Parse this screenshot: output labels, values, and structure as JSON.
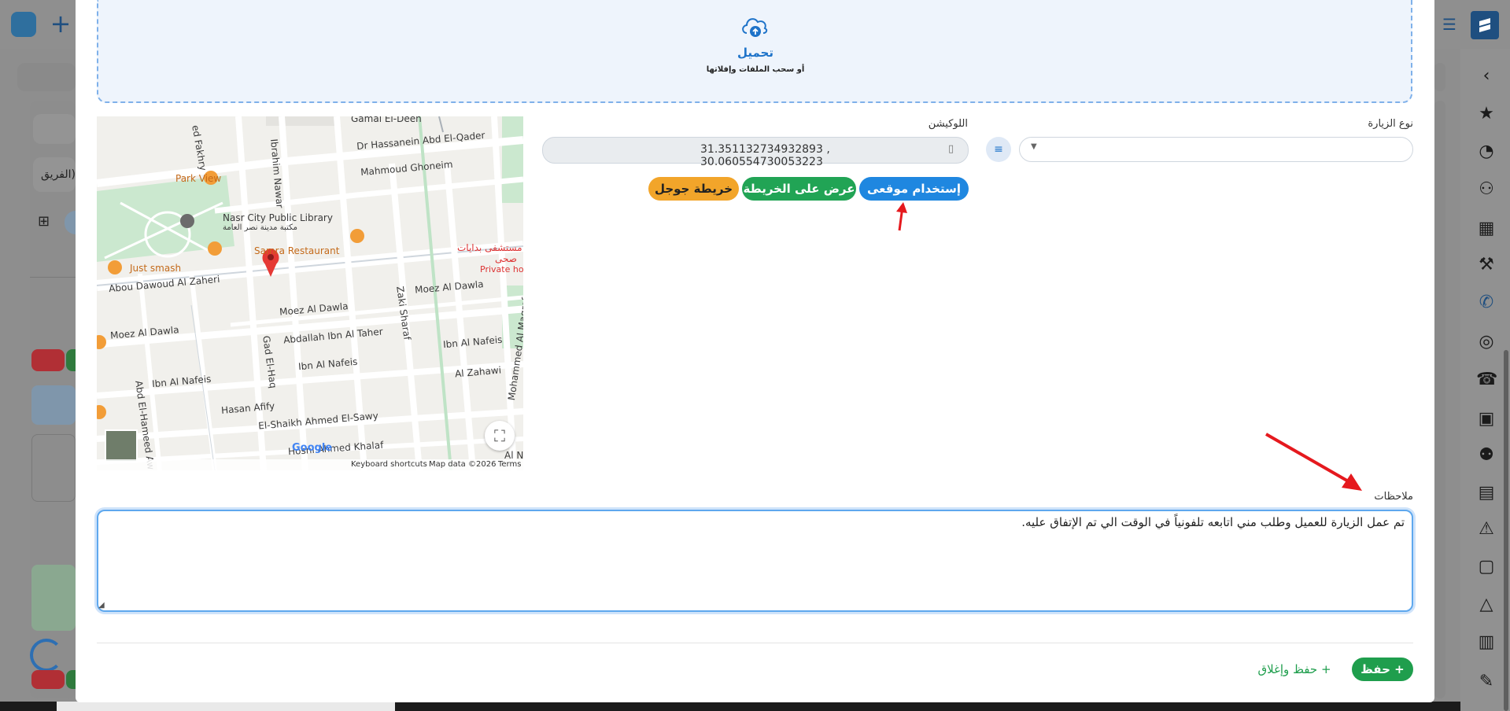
{
  "upload": {
    "title": "تحميل",
    "subtitle": "أو سحب الملفات وإفلاتها"
  },
  "form": {
    "location_label": "اللوكيشن",
    "location_value": "31.351132734932893 , 30.060554730053223",
    "visit_type_label": "نوع الزيارة",
    "visit_type_value": "",
    "buttons": {
      "use_my_location": "إستخدام موقعى",
      "show_on_map": "عرض على الخريطة",
      "google_map": "خريطة جوجل"
    },
    "notes_label": "ملاحظات",
    "notes_value": "تم عمل الزيارة للعميل وطلب مني اتابعه تلفونياً في الوقت الي تم الإتفاق عليه."
  },
  "actions": {
    "save": "حفظ",
    "save_and_close": "حفظ وإغلاق"
  },
  "map": {
    "labels": {
      "gamal": "Gamal El-Deen",
      "fakhry": "ed Fakhry",
      "ibrahim_nawar": "Ibrahim Nawar",
      "hassanein": "Dr Hassanein Abd El-Qader",
      "mahmoud_ghoneim": "Mahmoud Ghoneim",
      "park_view": "Park View",
      "library": "Nasr City Public Library",
      "library_ar": "مكتبة مدينة نصر العامة",
      "samra": "Samra Restaurant",
      "just_smash": "Just smash",
      "abou_dawoud": "Abou Dawoud Al Zaheri",
      "moez_1": "Moez Al Dawla",
      "moez_2": "Moez Al Dawla",
      "moez_3": "Moez Al Dawla",
      "zaki_sharaf": "Zaki Sharaf",
      "abdallah": "Abdallah Ibn Al Taher",
      "gad_elhaq": "Gad El-Haq",
      "ibn_nafeis_1": "Ibn Al Nafeis",
      "ibn_nafeis_2": "Ibn Al Nafeis",
      "ibn_nafeis_3": "Ibn Al Nafeis",
      "hasan_afify": "Hasan Afify",
      "al_zahawi": "Al Zahawi",
      "el_shaikh": "El-Shaikh Ahmed El-Sawy",
      "abd_elhameed": "Abd El-Hameed Aw",
      "hosni": "Hosni Ahmed Khalaf",
      "mohammed_maqref": "Mohammed Al Maqref",
      "al_na": "Al Na",
      "hospital_ar": "مستشفى بدايات",
      "hospital_ar2": "صحى",
      "private_hos": "Private hos"
    },
    "google": "Google",
    "footer": {
      "shortcuts": "Keyboard shortcuts",
      "data": "Map data ©2026",
      "terms": "Terms"
    }
  },
  "background": {
    "team_text": "الفريق)"
  },
  "colors": {
    "primary_blue": "#1f87e0",
    "green": "#21a455",
    "orange": "#f2a52a",
    "save_green": "#1f9e4d",
    "annotation_red": "#e5191e"
  }
}
